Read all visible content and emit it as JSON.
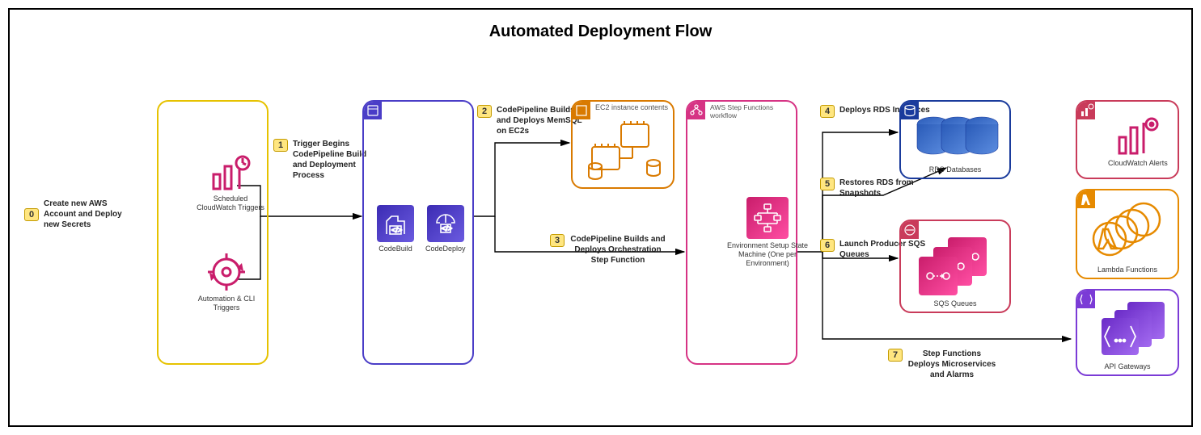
{
  "title": "Automated Deployment Flow",
  "steps": {
    "s0": "Create new AWS Account and Deploy new Secrets",
    "s1": "Trigger Begins CodePipeline Build and Deployment Process",
    "s2": "CodePipeline Builds and Deploys MemSQL on EC2s",
    "s3": "CodePipeline Builds and Deploys Orchestration Step Function",
    "s4": "Deploys RDS Instances",
    "s5": "Restores RDS from Snapshots",
    "s6": "Launch Producer SQS Queues",
    "s7": "Step Functions Deploys Microservices and Alarms"
  },
  "step_nums": {
    "s0": "0",
    "s1": "1",
    "s2": "2",
    "s3": "3",
    "s4": "4",
    "s5": "5",
    "s6": "6",
    "s7": "7"
  },
  "labels": {
    "cloudwatch_triggers": "Scheduled CloudWatch Triggers",
    "cli_triggers": "Automation & CLI Triggers",
    "codebuild": "CodeBuild",
    "codedeploy": "CodeDeploy",
    "ec2_header": "EC2 instance contents",
    "step_header": "AWS Step Functions workflow",
    "state_machine": "Environment Setup State Machine (One per Environment)",
    "rds": "RDS Databases",
    "sqs": "SQS Queues",
    "cloudwatch_alerts": "CloudWatch Alerts",
    "lambda": "Lambda Functions",
    "api_gw": "API Gateways"
  }
}
